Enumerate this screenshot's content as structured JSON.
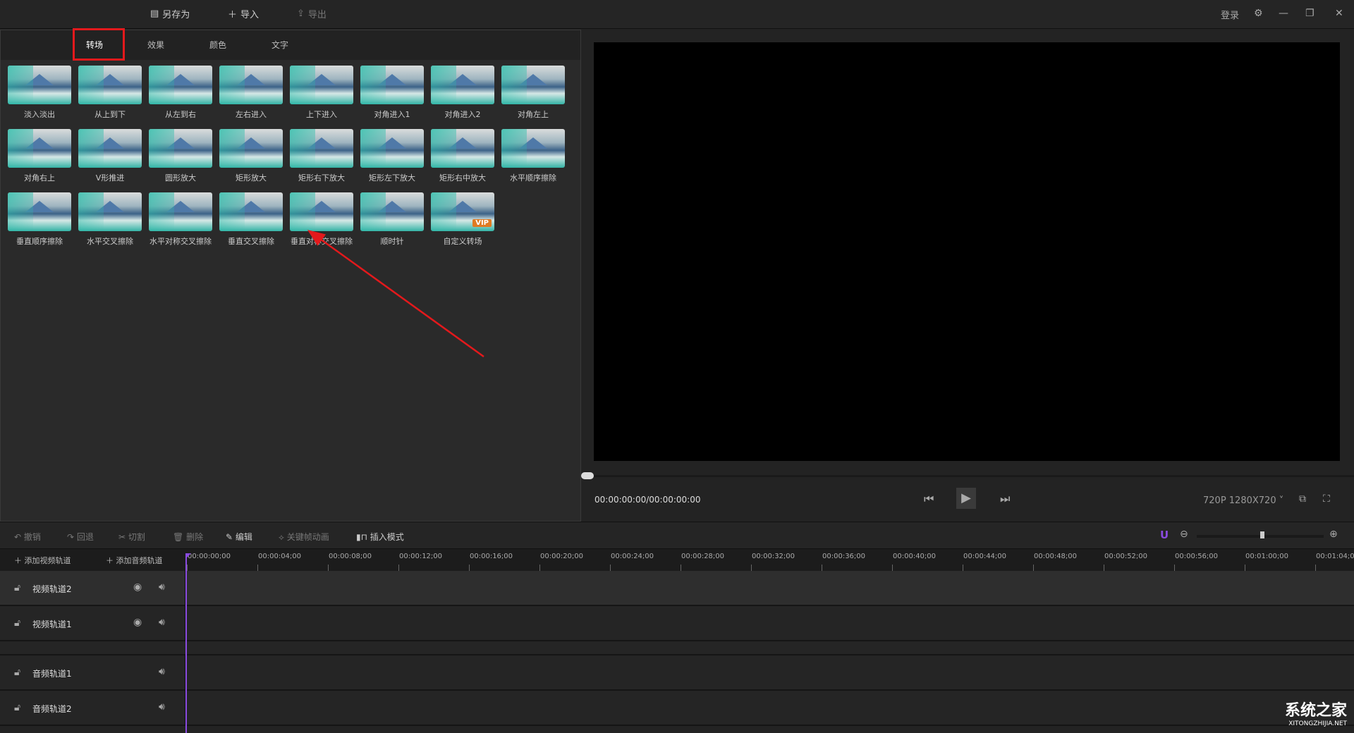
{
  "toolbar": {
    "save_as": "另存为",
    "import": "导入",
    "export": "导出",
    "login": "登录"
  },
  "tabs": [
    "转场",
    "效果",
    "颜色",
    "文字"
  ],
  "active_tab": "转场",
  "transitions": [
    {
      "label": "淡入淡出"
    },
    {
      "label": "从上到下"
    },
    {
      "label": "从左到右"
    },
    {
      "label": "左右进入"
    },
    {
      "label": "上下进入"
    },
    {
      "label": "对角进入1"
    },
    {
      "label": "对角进入2"
    },
    {
      "label": "对角左上"
    },
    {
      "label": "对角右上"
    },
    {
      "label": "V形推进"
    },
    {
      "label": "圆形放大"
    },
    {
      "label": "矩形放大"
    },
    {
      "label": "矩形右下放大"
    },
    {
      "label": "矩形左下放大"
    },
    {
      "label": "矩形右中放大"
    },
    {
      "label": "水平顺序擦除"
    },
    {
      "label": "垂直顺序擦除"
    },
    {
      "label": "水平交叉擦除"
    },
    {
      "label": "水平对称交叉擦除"
    },
    {
      "label": "垂直交叉擦除"
    },
    {
      "label": "垂直对称交叉擦除"
    },
    {
      "label": "顺时针"
    },
    {
      "label": "自定义转场",
      "badge": "VIP"
    }
  ],
  "player": {
    "time": "00:00:00:00/00:00:00:00",
    "resolution": "720P 1280X720",
    "progress": 0
  },
  "timeline_toolbar": {
    "undo": "撤销",
    "redo": "回退",
    "cut": "切割",
    "delete": "删除",
    "edit": "编辑",
    "keyframe": "关键帧动画",
    "insert_mode": "插入模式"
  },
  "add_video_track": "添加视频轨道",
  "add_audio_track": "添加音频轨道",
  "ruler": [
    "00:00:00;00",
    "00:00:04;00",
    "00:00:08;00",
    "00:00:12;00",
    "00:00:16;00",
    "00:00:20;00",
    "00:00:24;00",
    "00:00:28;00",
    "00:00:32;00",
    "00:00:36;00",
    "00:00:40;00",
    "00:00:44;00",
    "00:00:48;00",
    "00:00:52;00",
    "00:00:56;00",
    "00:01:00;00",
    "00:01:04;00"
  ],
  "tracks": [
    {
      "name": "视频轨道2",
      "type": "video"
    },
    {
      "name": "视频轨道1",
      "type": "video"
    },
    {
      "name": "音频轨道1",
      "type": "audio"
    },
    {
      "name": "音频轨道2",
      "type": "audio"
    }
  ],
  "watermark": {
    "name": "系统之家",
    "url": "XITONGZHIJIA.NET"
  },
  "colors": {
    "accent": "#8a4be0",
    "annotation": "#e3191c"
  }
}
